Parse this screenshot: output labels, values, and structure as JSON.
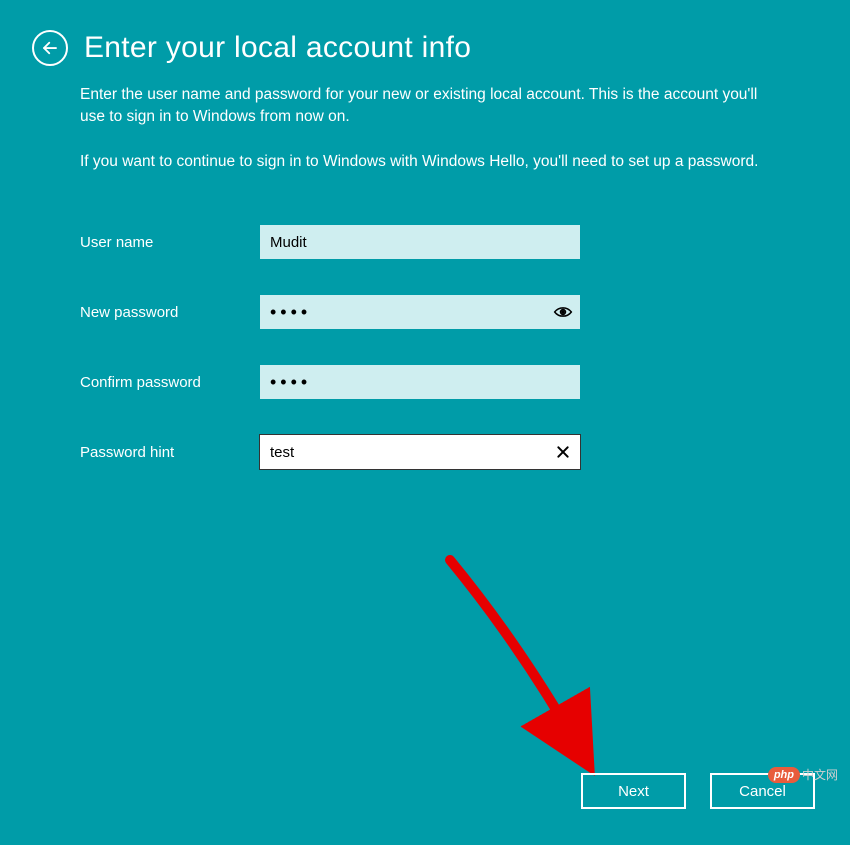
{
  "header": {
    "title": "Enter your local account info"
  },
  "description": {
    "p1": "Enter the user name and password for your new or existing local account. This is the account you'll use to sign in to Windows from now on.",
    "p2": "If you want to continue to sign in to Windows with Windows Hello, you'll need to set up a password."
  },
  "form": {
    "username_label": "User name",
    "username_value": "Mudit",
    "newpassword_label": "New password",
    "newpassword_mask": "••••",
    "confirmpassword_label": "Confirm password",
    "confirmpassword_mask": "••••",
    "passwordhint_label": "Password hint",
    "passwordhint_value": "test"
  },
  "buttons": {
    "next": "Next",
    "cancel": "Cancel"
  },
  "watermark": {
    "badge": "php",
    "suffix": "中文网"
  }
}
